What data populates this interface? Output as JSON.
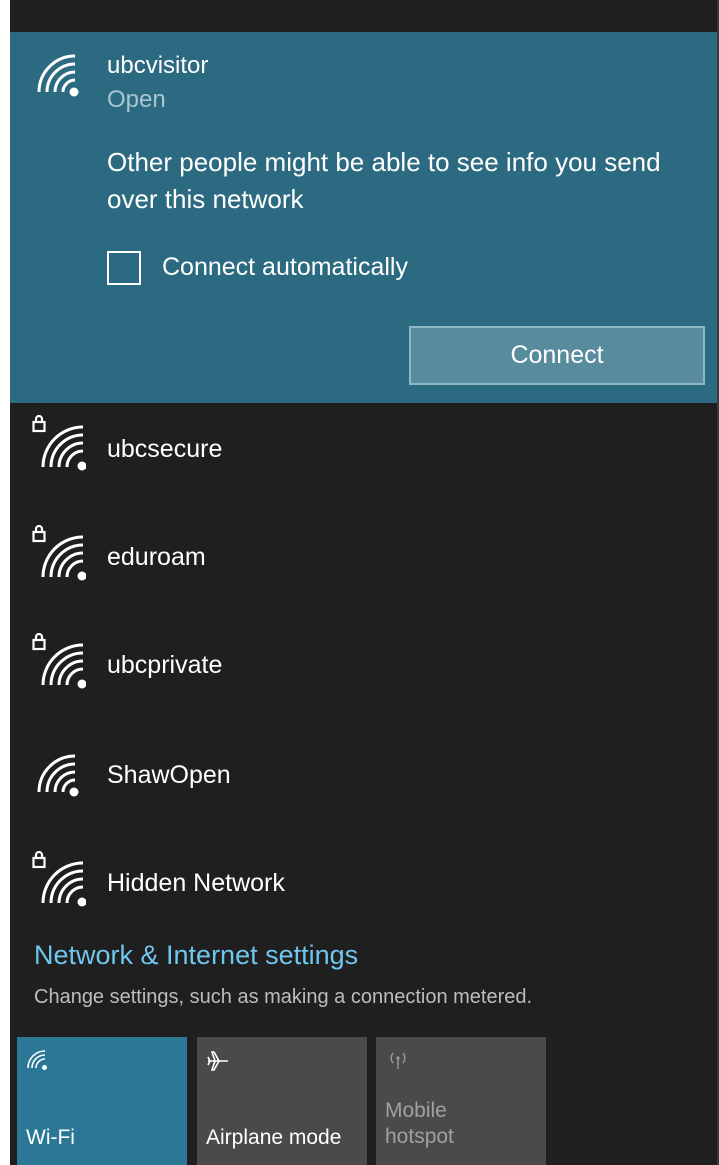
{
  "selected_network": {
    "name": "ubcvisitor",
    "status": "Open",
    "warning": "Other people might be able to see info you send over this network",
    "auto_connect_label": "Connect automatically",
    "auto_connect_checked": false,
    "connect_label": "Connect",
    "icon": "wifi-signal-icon"
  },
  "networks": [
    {
      "name": "ubcsecure",
      "secured": true,
      "icon": "wifi-lock-icon"
    },
    {
      "name": "eduroam",
      "secured": true,
      "icon": "wifi-lock-icon"
    },
    {
      "name": "ubcprivate",
      "secured": true,
      "icon": "wifi-lock-icon"
    },
    {
      "name": "ShawOpen",
      "secured": false,
      "icon": "wifi-signal-icon"
    },
    {
      "name": "Hidden Network",
      "secured": true,
      "icon": "wifi-lock-icon"
    }
  ],
  "settings": {
    "link": "Network & Internet settings",
    "description": "Change settings, such as making a connection metered."
  },
  "quick_actions": [
    {
      "label": "Wi-Fi",
      "state": "on",
      "icon": "wifi-icon"
    },
    {
      "label": "Airplane mode",
      "state": "off",
      "icon": "airplane-icon"
    },
    {
      "label": "Mobile hotspot",
      "state": "disabled",
      "icon": "hotspot-icon"
    }
  ],
  "colors": {
    "accent": "#2b6a80",
    "background": "#1f1f1f",
    "link": "#6fc6ee",
    "tile_on": "#2b7896",
    "tile_off": "#4a4a4a"
  }
}
